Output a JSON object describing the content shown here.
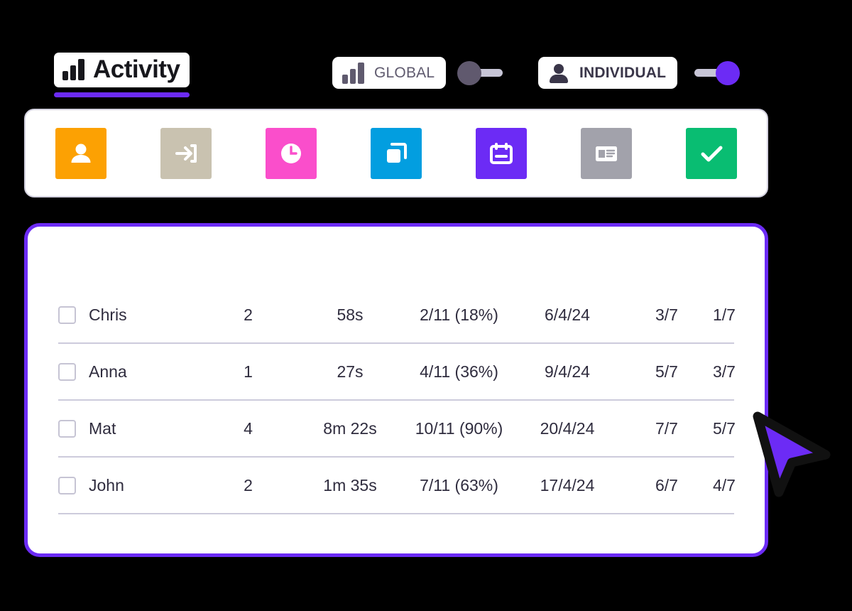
{
  "header": {
    "title": "Activity",
    "title_icon": "bar-chart-icon",
    "accent_color": "#6c2bf5",
    "toggles": [
      {
        "label": "GLOBAL",
        "icon": "bar-chart-icon",
        "state": "off",
        "knob_color": "#60596e",
        "track_color": "#c7c5d6"
      },
      {
        "label": "INDIVIDUAL",
        "icon": "person-icon",
        "state": "on",
        "knob_color": "#6c2bf5",
        "track_color": "#c7c5d6"
      }
    ]
  },
  "toolbar": {
    "items": [
      {
        "icon": "person-icon",
        "color": "#fca103",
        "label": "Profile"
      },
      {
        "icon": "login-arrow-icon",
        "color": "#c9c2b0",
        "label": "Login"
      },
      {
        "icon": "clock-icon",
        "color": "#fa4ecb",
        "label": "Time"
      },
      {
        "icon": "copy-icon",
        "color": "#029ee0",
        "label": "Duplicate"
      },
      {
        "icon": "calendar-icon",
        "color": "#6c2bf5",
        "label": "Calendar"
      },
      {
        "icon": "id-card-icon",
        "color": "#a2a2ab",
        "label": "Details"
      },
      {
        "icon": "check-icon",
        "color": "#09bd72",
        "label": "Completed"
      }
    ]
  },
  "table": {
    "rows": [
      {
        "name": "Chris",
        "logins": "2",
        "time": "58s",
        "progress": "2/11 (18%)",
        "date": "6/4/24",
        "modules": "3/7",
        "completed": "1/7",
        "checked": false
      },
      {
        "name": "Anna",
        "logins": "1",
        "time": "27s",
        "progress": "4/11 (36%)",
        "date": "9/4/24",
        "modules": "5/7",
        "completed": "3/7",
        "checked": false
      },
      {
        "name": "Mat",
        "logins": "4",
        "time": "8m 22s",
        "progress": "10/11 (90%)",
        "date": "20/4/24",
        "modules": "7/7",
        "completed": "5/7",
        "checked": false
      },
      {
        "name": "John",
        "logins": "2",
        "time": "1m 35s",
        "progress": "7/11 (63%)",
        "date": "17/4/24",
        "modules": "6/7",
        "completed": "4/7",
        "checked": false
      }
    ]
  },
  "cursor": {
    "icon": "arrow-pointer-icon",
    "fill": "#6c2bf5",
    "outline": "#111111"
  }
}
